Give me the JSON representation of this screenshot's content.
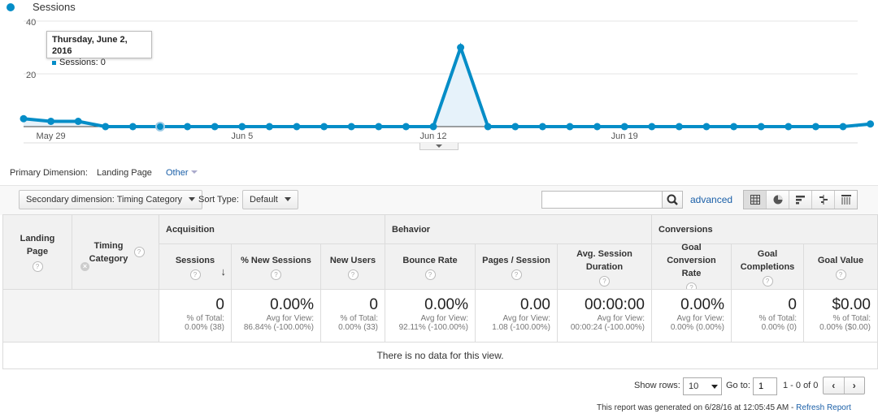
{
  "legend": {
    "label": "Sessions",
    "color": "#058dc7"
  },
  "chart_data": {
    "type": "area",
    "title": "",
    "series": [
      {
        "name": "Sessions",
        "values": [
          3,
          2,
          2,
          0,
          0,
          0,
          0,
          0,
          0,
          0,
          0,
          0,
          0,
          0,
          0,
          0,
          30,
          0,
          0,
          0,
          0,
          0,
          0,
          0,
          0,
          0,
          0,
          0,
          0,
          0,
          0,
          1
        ]
      }
    ],
    "x": [
      "May 28",
      "May 29",
      "May 30",
      "May 31",
      "Jun 1",
      "Jun 2",
      "Jun 3",
      "Jun 4",
      "Jun 5",
      "Jun 6",
      "Jun 7",
      "Jun 8",
      "Jun 9",
      "Jun 10",
      "Jun 11",
      "Jun 12",
      "Jun 13",
      "Jun 14",
      "Jun 15",
      "Jun 16",
      "Jun 17",
      "Jun 18",
      "Jun 19",
      "Jun 20",
      "Jun 21",
      "Jun 22",
      "Jun 23",
      "Jun 24",
      "Jun 25",
      "Jun 26",
      "Jun 27",
      "Jun 28"
    ],
    "x_tick_labels": [
      "May 29",
      "Jun 5",
      "Jun 12",
      "Jun 19"
    ],
    "y_tick_labels": [
      "40",
      "20"
    ],
    "ylim": [
      0,
      40
    ],
    "grid": true
  },
  "tooltip": {
    "date": "Thursday, June 2, 2016",
    "line": "Sessions: 0"
  },
  "primary_dimension": {
    "label": "Primary Dimension:",
    "value": "Landing Page",
    "other": "Other"
  },
  "toolbar": {
    "secondary_dimension": "Secondary dimension: Timing Category",
    "sort_type_label": "Sort Type:",
    "sort_type_value": "Default",
    "search_placeholder": "",
    "advanced": "advanced"
  },
  "table": {
    "groups": {
      "acquisition": "Acquisition",
      "behavior": "Behavior",
      "conversions": "Conversions"
    },
    "dim_headers": {
      "landing_page": "Landing Page",
      "timing_category": "Timing Category"
    },
    "columns": [
      {
        "label": "Sessions",
        "value": "0",
        "sub1": "% of Total:",
        "sub2": "0.00% (38)"
      },
      {
        "label": "% New Sessions",
        "value": "0.00%",
        "sub1": "Avg for View:",
        "sub2": "86.84% (-100.00%)"
      },
      {
        "label": "New Users",
        "value": "0",
        "sub1": "% of Total:",
        "sub2": "0.00% (33)"
      },
      {
        "label": "Bounce Rate",
        "value": "0.00%",
        "sub1": "Avg for View:",
        "sub2": "92.11% (-100.00%)"
      },
      {
        "label": "Pages / Session",
        "value": "0.00",
        "sub1": "Avg for View:",
        "sub2": "1.08 (-100.00%)"
      },
      {
        "label": "Avg. Session Duration",
        "value": "00:00:00",
        "sub1": "Avg for View:",
        "sub2": "00:00:24 (-100.00%)"
      },
      {
        "label": "Goal Conversion Rate",
        "value": "0.00%",
        "sub1": "Avg for View:",
        "sub2": "0.00% (0.00%)"
      },
      {
        "label": "Goal Completions",
        "value": "0",
        "sub1": "% of Total:",
        "sub2": "0.00% (0)"
      },
      {
        "label": "Goal Value",
        "value": "$0.00",
        "sub1": "% of Total:",
        "sub2": "0.00% ($0.00)"
      }
    ],
    "no_data": "There is no data for this view."
  },
  "footer": {
    "show_rows_label": "Show rows:",
    "show_rows_value": "10",
    "goto_label": "Go to:",
    "goto_value": "1",
    "range": "1 - 0 of 0",
    "prev": "‹",
    "next": "›",
    "generated": "This report was generated on 6/28/16 at 12:05:45 AM -",
    "refresh": "Refresh Report"
  }
}
